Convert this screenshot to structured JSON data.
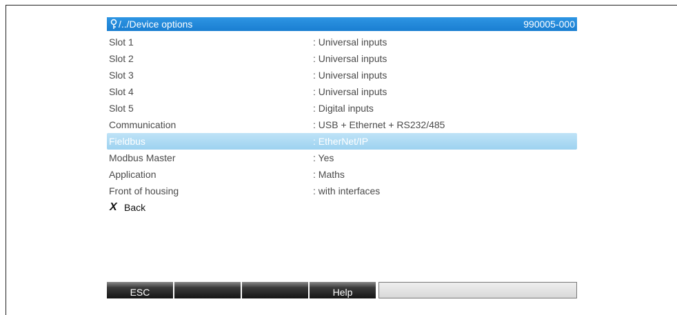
{
  "title": {
    "path": "/../Device options",
    "code": "990005-000"
  },
  "icons": {
    "path": "menu-key-icon",
    "back": "close-x-icon"
  },
  "rows": [
    {
      "label": "Slot 1",
      "value": ": Universal inputs"
    },
    {
      "label": "Slot 2",
      "value": ": Universal inputs"
    },
    {
      "label": "Slot 3",
      "value": ": Universal inputs"
    },
    {
      "label": "Slot 4",
      "value": ": Universal inputs"
    },
    {
      "label": "Slot 5",
      "value": ": Digital inputs"
    },
    {
      "label": "Communication",
      "value": ": USB + Ethernet + RS232/485"
    },
    {
      "label": "Fieldbus",
      "value": ": EtherNet/IP",
      "selected": true
    },
    {
      "label": "Modbus Master",
      "value": ": Yes"
    },
    {
      "label": "Application",
      "value": ": Maths"
    },
    {
      "label": "Front of housing",
      "value": ": with interfaces"
    }
  ],
  "back": {
    "label": "Back"
  },
  "softkeys": [
    "ESC",
    "",
    "",
    "Help",
    ""
  ],
  "colors": {
    "titlebar": "#1f86d8",
    "selected_row": "#a9d8f2",
    "text": "#4a4a4a"
  }
}
